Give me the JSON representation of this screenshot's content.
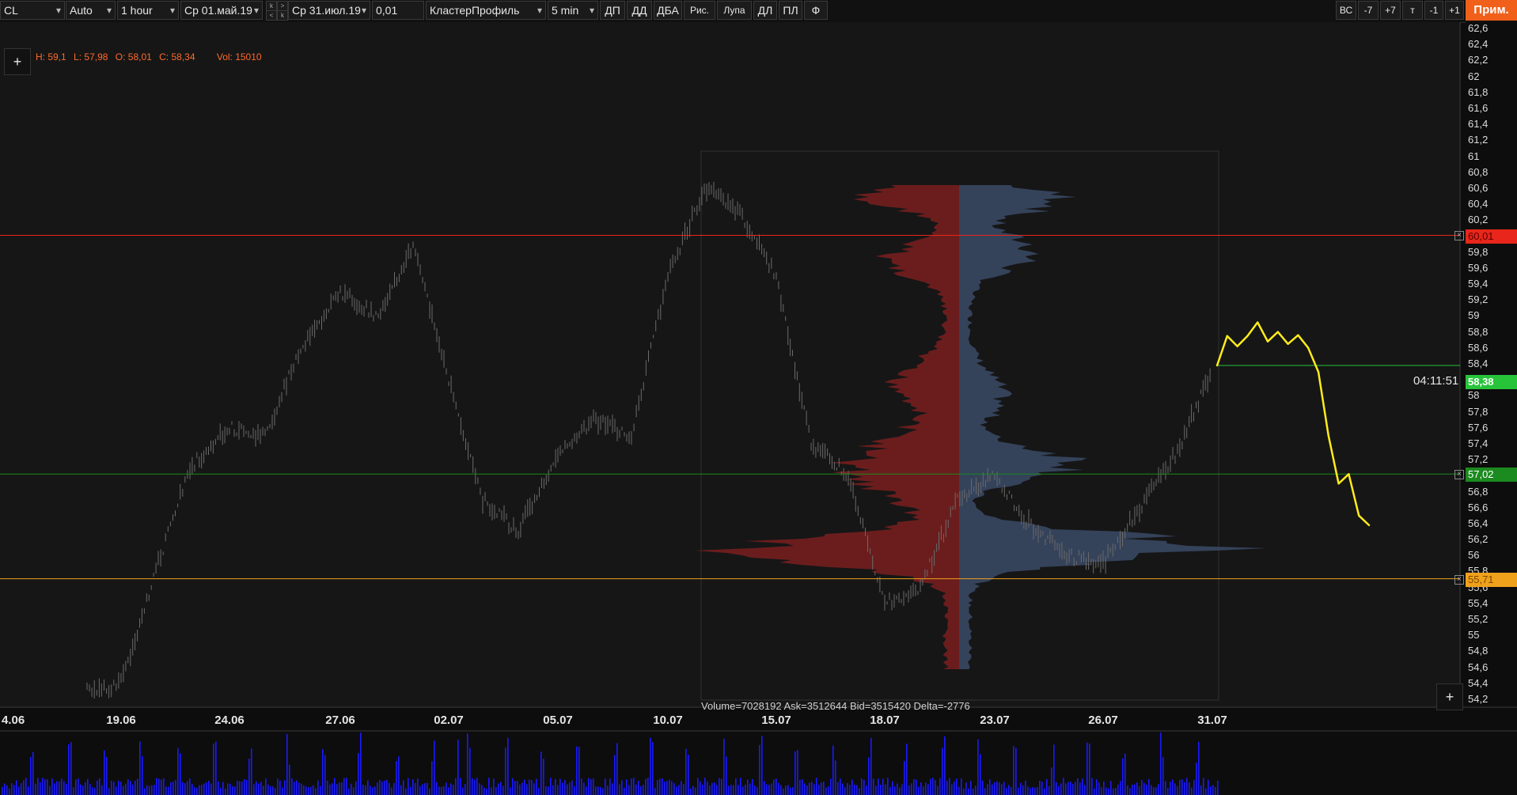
{
  "toolbar": {
    "symbol": "CL",
    "scale_mode": "Auto",
    "timeframe": "1 hour",
    "date_from": "Ср 01.май.19",
    "date_to": "Ср 31.июл.19",
    "step": "0,01",
    "profile_type": "КластерПрофиль",
    "profile_period": "5 min",
    "buttons": [
      "ДП",
      "ДД",
      "ДБА",
      "Рис.",
      "Лупа",
      "ДЛ",
      "ПЛ",
      "Ф"
    ],
    "right_buttons": [
      "ВС",
      "-7",
      "+7",
      "т",
      "-1",
      "+1"
    ],
    "prim_label": "Прим."
  },
  "ohlc": {
    "h": "H: 59,1",
    "l": "L: 57,98",
    "o": "O: 58,01",
    "c": "C: 58,34",
    "vol": "Vol: 15010"
  },
  "plus_label": "+",
  "volume_summary": "Volume=7028192  Ask=3512644  Bid=3515420  Delta=-2776",
  "timer": "04:11:51",
  "price_tags": {
    "resistance": "60,01",
    "last": "58,38",
    "support": "57,02",
    "low": "55,71"
  },
  "colors": {
    "resistance": "#e8261b",
    "last": "#27c43a",
    "support": "#1b8a1f",
    "low": "#f0a11c",
    "annotation": "#ffec1a",
    "bid_profile": "#7a1f1f",
    "ask_profile": "#3a4a66",
    "volume_bars": "#1a1aff"
  },
  "y_axis_ticks": [
    "62,6",
    "62,4",
    "62,2",
    "62",
    "61,8",
    "61,6",
    "61,4",
    "61,2",
    "61",
    "60,8",
    "60,6",
    "60,4",
    "60,2",
    "60",
    "59,8",
    "59,6",
    "59,4",
    "59,2",
    "59",
    "58,8",
    "58,6",
    "58,4",
    "58,2",
    "58",
    "57,8",
    "57,6",
    "57,4",
    "57,2",
    "57",
    "56,8",
    "56,6",
    "56,4",
    "56,2",
    "56",
    "55,8",
    "55,6",
    "55,4",
    "55,2",
    "55",
    "54,8",
    "54,6",
    "54,4",
    "54,2"
  ],
  "x_axis_ticks": [
    "4.06",
    "19.06",
    "24.06",
    "27.06",
    "02.07",
    "05.07",
    "10.07",
    "15.07",
    "18.07",
    "23.07",
    "26.07",
    "31.07"
  ],
  "chart_data": {
    "type": "candlestick",
    "timeframe": "1 hour",
    "ylim": [
      54.2,
      62.6
    ],
    "levels": [
      {
        "name": "resistance",
        "price": 60.01
      },
      {
        "name": "last",
        "price": 58.38
      },
      {
        "name": "support",
        "price": 57.02
      },
      {
        "name": "low",
        "price": 55.71
      }
    ],
    "price_path": [
      {
        "date": "17.06",
        "price": 54.3
      },
      {
        "date": "19.06",
        "price": 54.4
      },
      {
        "date": "20.06",
        "price": 55.9
      },
      {
        "date": "21.06",
        "price": 57.1
      },
      {
        "date": "24.06",
        "price": 57.6
      },
      {
        "date": "25.06",
        "price": 57.5
      },
      {
        "date": "26.06",
        "price": 58.6
      },
      {
        "date": "27.06",
        "price": 59.3
      },
      {
        "date": "28.06",
        "price": 59.0
      },
      {
        "date": "01.07",
        "price": 59.9
      },
      {
        "date": "02.07",
        "price": 58.2
      },
      {
        "date": "03.07",
        "price": 56.7
      },
      {
        "date": "04.07",
        "price": 56.3
      },
      {
        "date": "05.07",
        "price": 57.3
      },
      {
        "date": "08.07",
        "price": 57.7
      },
      {
        "date": "09.07",
        "price": 57.5
      },
      {
        "date": "10.07",
        "price": 59.5
      },
      {
        "date": "11.07",
        "price": 60.6
      },
      {
        "date": "12.07",
        "price": 60.3
      },
      {
        "date": "15.07",
        "price": 59.5
      },
      {
        "date": "16.07",
        "price": 57.4
      },
      {
        "date": "17.07",
        "price": 57.0
      },
      {
        "date": "18.07",
        "price": 55.4
      },
      {
        "date": "19.07",
        "price": 55.6
      },
      {
        "date": "22.07",
        "price": 56.7
      },
      {
        "date": "23.07",
        "price": 57.0
      },
      {
        "date": "24.07",
        "price": 56.4
      },
      {
        "date": "25.07",
        "price": 56.0
      },
      {
        "date": "26.07",
        "price": 55.9
      },
      {
        "date": "29.07",
        "price": 56.6
      },
      {
        "date": "30.07",
        "price": 57.3
      },
      {
        "date": "31.07",
        "price": 58.34
      }
    ],
    "annotation_path": [
      {
        "step": 0,
        "price": 58.38
      },
      {
        "step": 1,
        "price": 58.75
      },
      {
        "step": 2,
        "price": 58.62
      },
      {
        "step": 3,
        "price": 58.75
      },
      {
        "step": 4,
        "price": 58.92
      },
      {
        "step": 5,
        "price": 58.68
      },
      {
        "step": 6,
        "price": 58.8
      },
      {
        "step": 7,
        "price": 58.65
      },
      {
        "step": 8,
        "price": 58.76
      },
      {
        "step": 9,
        "price": 58.6
      },
      {
        "step": 10,
        "price": 58.3
      },
      {
        "step": 11,
        "price": 57.5
      },
      {
        "step": 12,
        "price": 56.9
      },
      {
        "step": 13,
        "price": 57.02
      },
      {
        "step": 14,
        "price": 56.5
      },
      {
        "step": 15,
        "price": 56.38
      }
    ]
  }
}
